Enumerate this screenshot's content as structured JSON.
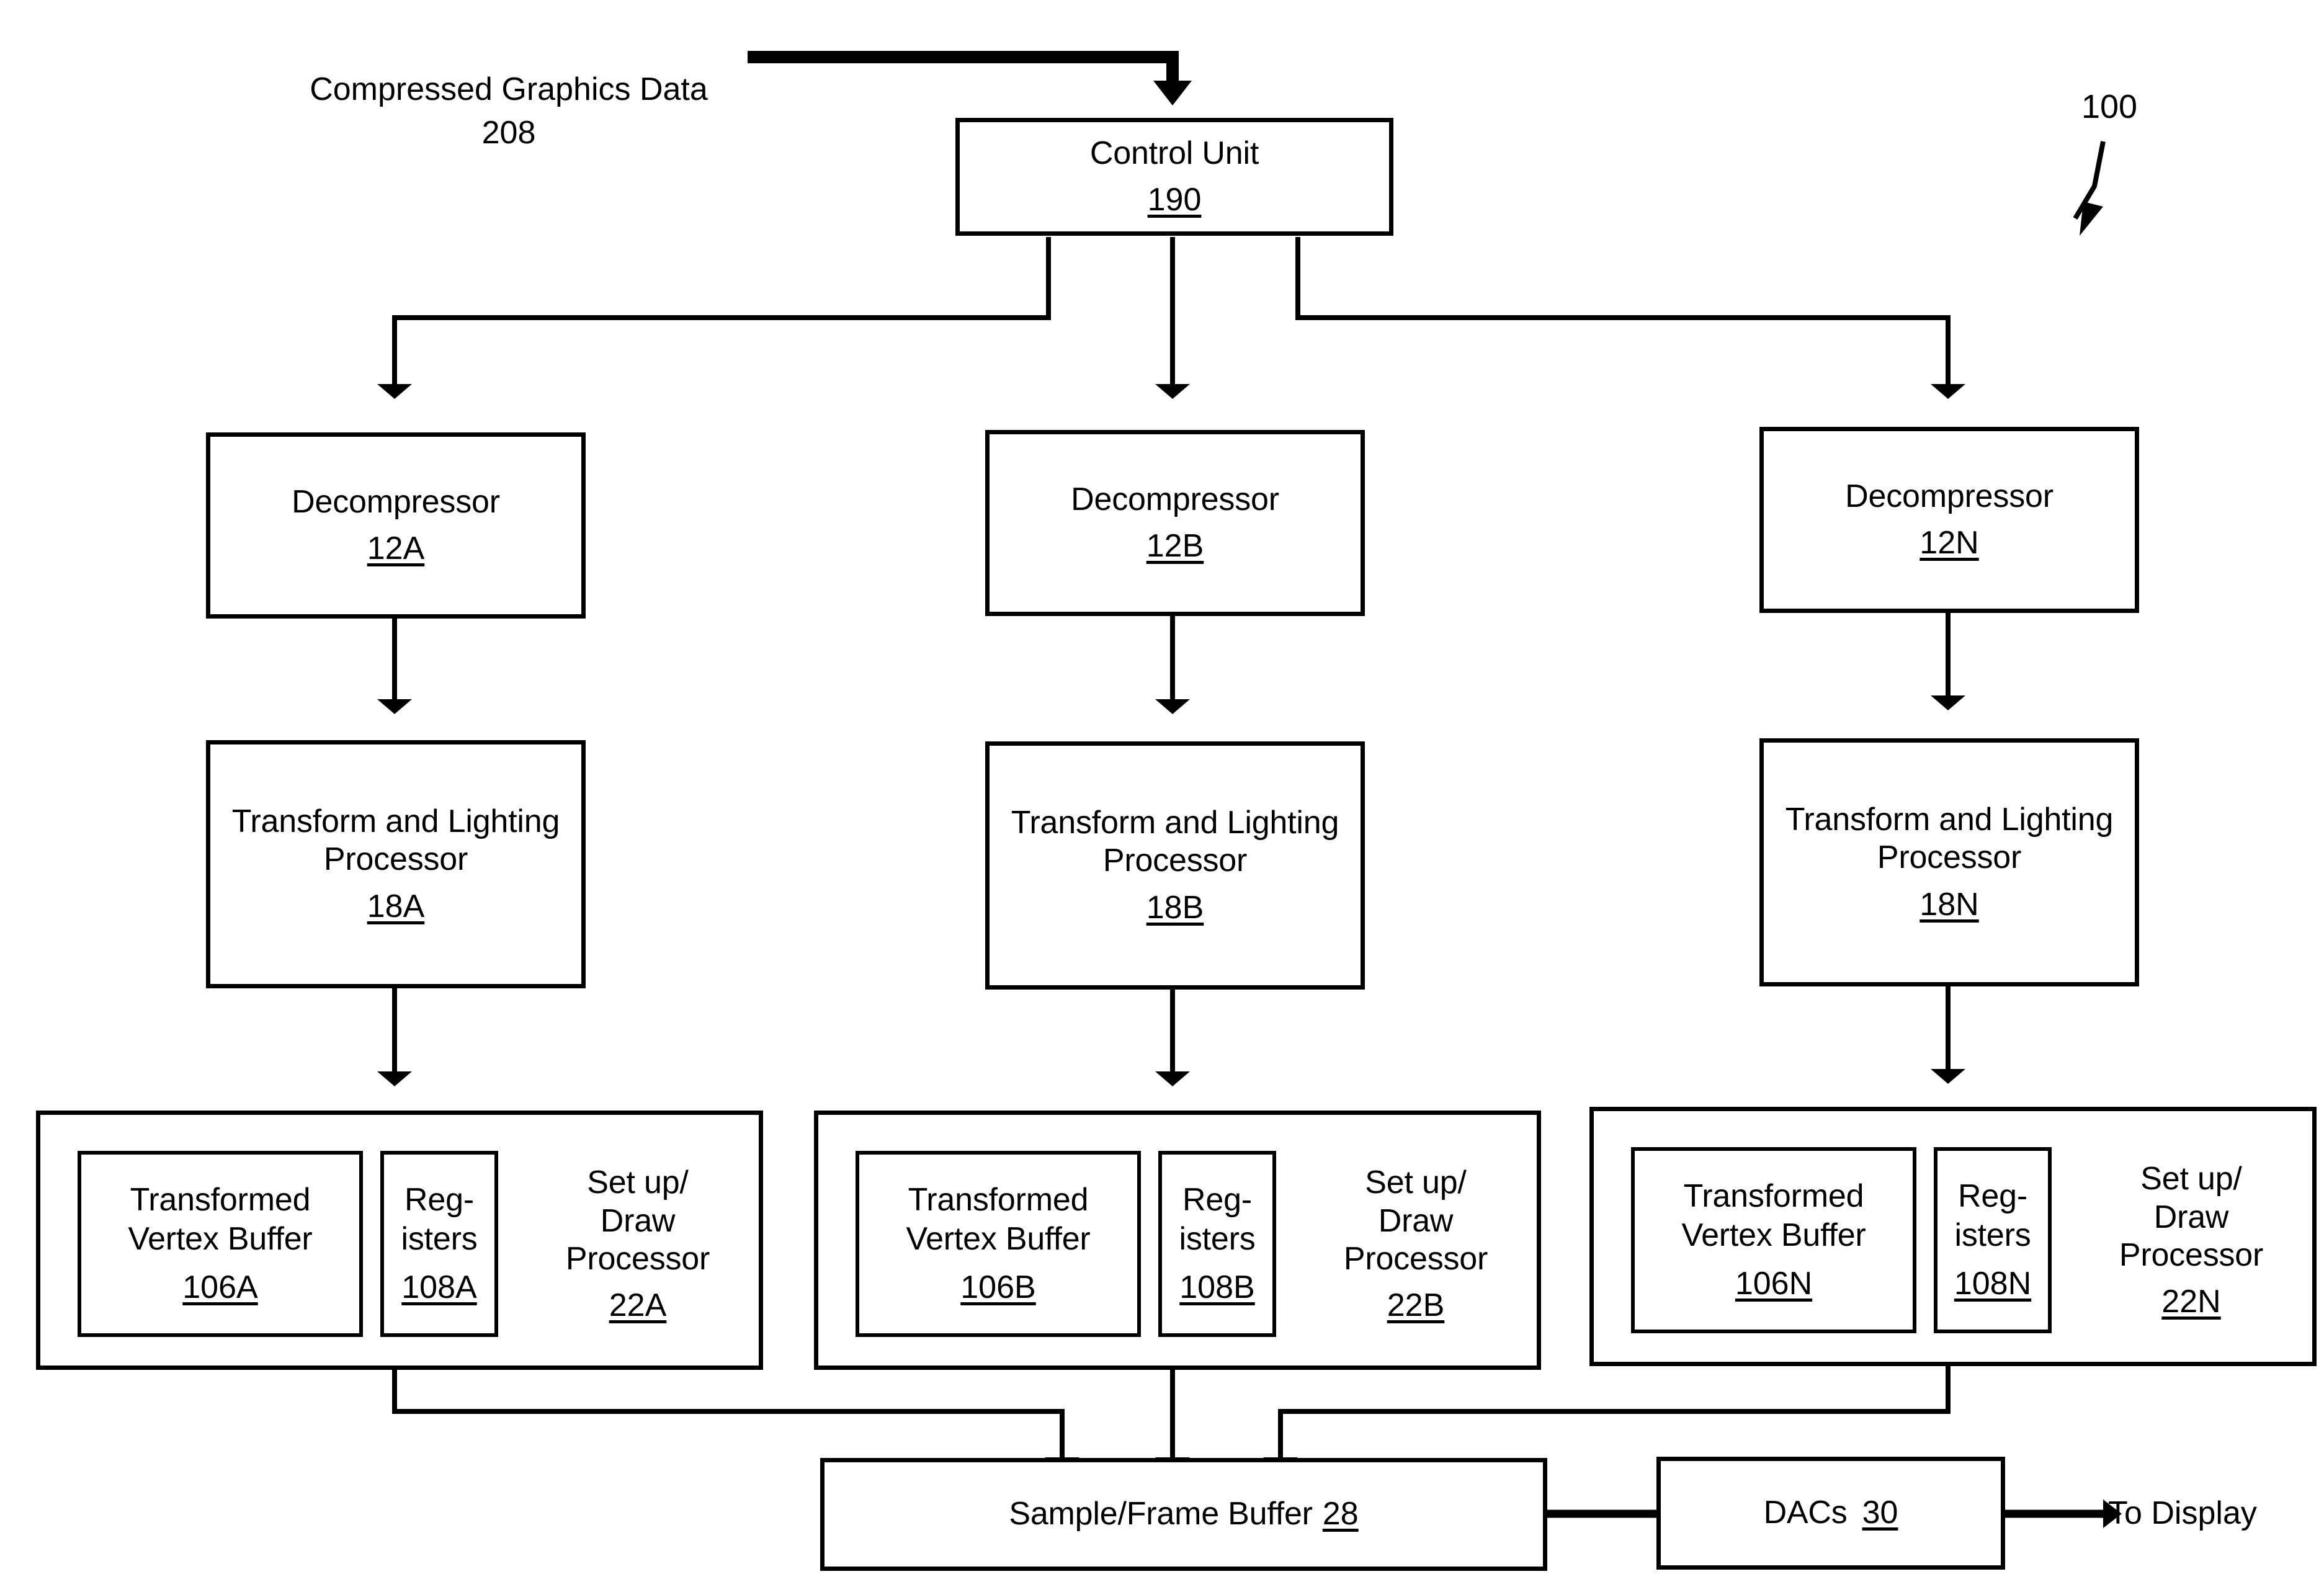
{
  "diagram": {
    "figure_ref": "100",
    "input_label": "Compressed Graphics Data",
    "input_ref": "208",
    "output_label": "To Display"
  },
  "control_unit": {
    "title": "Control Unit",
    "ref": "190"
  },
  "columns": [
    {
      "decompressor": {
        "title": "Decompressor",
        "ref": "12A"
      },
      "tnl": {
        "title": "Transform and Lighting\nProcessor",
        "ref": "18A"
      },
      "setup_draw": {
        "title": "Set up/\nDraw\nProcessor",
        "ref": "22A",
        "vertex_buffer": {
          "title": "Transformed\nVertex Buffer",
          "ref": "106A"
        },
        "registers": {
          "title": "Reg-\nisters",
          "ref": "108A"
        }
      }
    },
    {
      "decompressor": {
        "title": "Decompressor",
        "ref": "12B"
      },
      "tnl": {
        "title": "Transform and Lighting\nProcessor",
        "ref": "18B"
      },
      "setup_draw": {
        "title": "Set up/\nDraw\nProcessor",
        "ref": "22B",
        "vertex_buffer": {
          "title": "Transformed\nVertex Buffer",
          "ref": "106B"
        },
        "registers": {
          "title": "Reg-\nisters",
          "ref": "108B"
        }
      }
    },
    {
      "decompressor": {
        "title": "Decompressor",
        "ref": "12N"
      },
      "tnl": {
        "title": "Transform and Lighting\nProcessor",
        "ref": "18N"
      },
      "setup_draw": {
        "title": "Set up/\nDraw\nProcessor",
        "ref": "22N",
        "vertex_buffer": {
          "title": "Transformed\nVertex Buffer",
          "ref": "106N"
        },
        "registers": {
          "title": "Reg-\nisters",
          "ref": "108N"
        }
      }
    }
  ],
  "frame_buffer": {
    "title": "Sample/Frame Buffer",
    "ref": "28"
  },
  "dacs": {
    "title": "DACs",
    "ref": "30"
  },
  "colors": {
    "stroke": "#000000",
    "background": "#ffffff"
  }
}
